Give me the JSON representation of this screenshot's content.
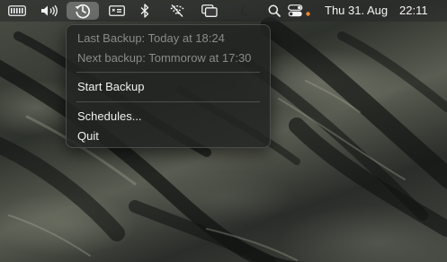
{
  "menubar": {
    "icons": [
      "keyboard-icon",
      "volume-icon",
      "time-machine-icon",
      "display-icon",
      "bluetooth-icon",
      "wifi-off-icon",
      "screen-mirroring-icon",
      "moon-icon",
      "search-icon",
      "control-center-icon"
    ],
    "date": "Thu 31. Aug",
    "time": "22:11"
  },
  "menu": {
    "last_backup": "Last Backup: Today at 18:24",
    "next_backup": "Next backup: Tommorow at 17:30",
    "start_backup": "Start Backup",
    "schedules": "Schedules...",
    "quit": "Quit"
  },
  "colors": {
    "menubar_bg": "#282828",
    "menu_bg": "#222422",
    "text": "#f0f0f0",
    "disabled_text": "#8a8a8a",
    "status_dot": "#f0892a"
  }
}
